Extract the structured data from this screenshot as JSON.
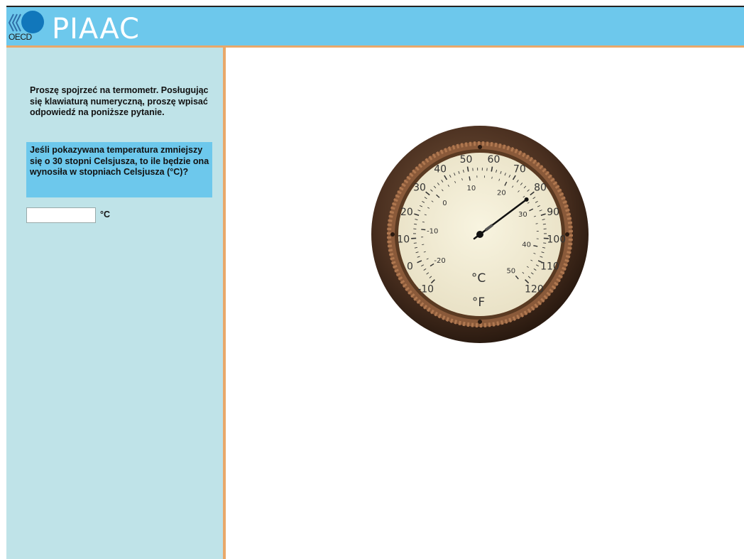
{
  "header": {
    "logo_text": "OECD",
    "brand": "PIAAC",
    "colors": {
      "header_bg": "#6dc8ec",
      "accent_rule": "#e9a86a",
      "sidebar_bg": "#bfe3e8"
    }
  },
  "task": {
    "instructions": "Proszę spojrzeć na termometr. Posługując się klawiaturą numeryczną, proszę wpisać odpowiedź na poniższe pytanie.",
    "question": "Jeśli pokazywana temperatura zmniejszy się o 30 stopni Celsjusza, to ile będzie ona wynosiła w stopniach Celsjusza (°C)?",
    "answer": {
      "value": "",
      "placeholder": ""
    },
    "unit": "°C"
  },
  "thermometer": {
    "fahrenheit_scale_labels": [
      "-10",
      "0",
      "10",
      "20",
      "30",
      "40",
      "50",
      "60",
      "70",
      "80",
      "90",
      "100",
      "110",
      "120"
    ],
    "celsius_scale_labels": [
      "-20",
      "-10",
      "0",
      "10",
      "20",
      "30",
      "40",
      "50"
    ],
    "celsius_unit_label": "°C",
    "fahrenheit_unit_label": "°F",
    "needle_reading_celsius": 27
  }
}
